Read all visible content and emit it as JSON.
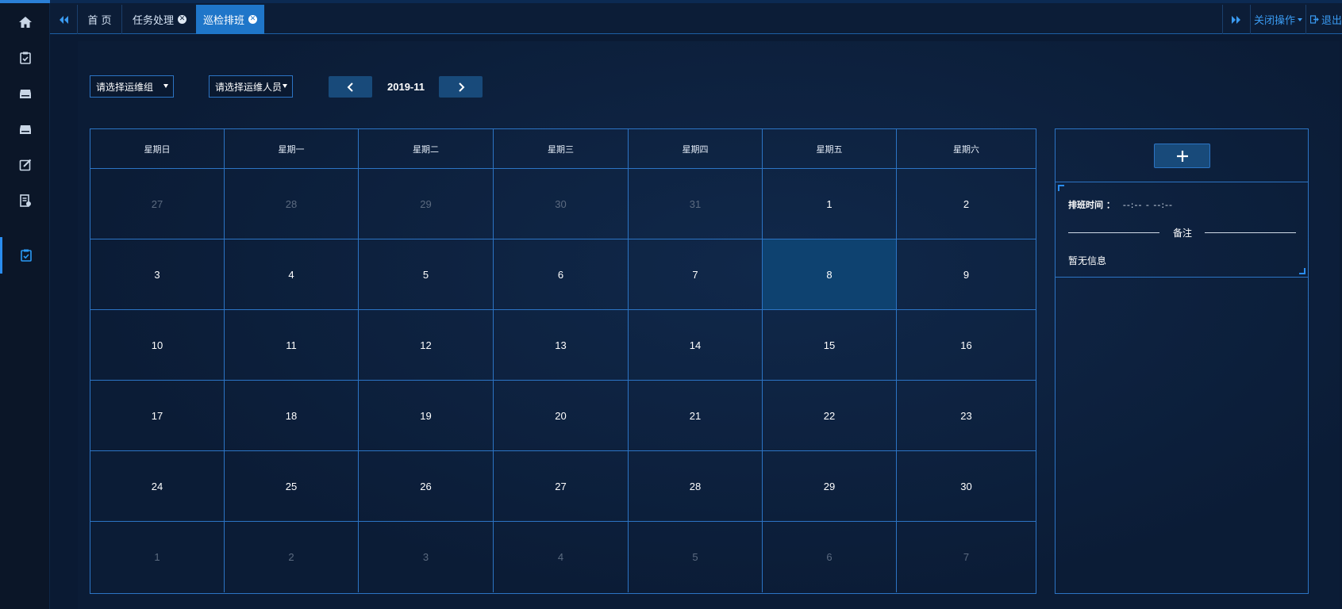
{
  "tabs": {
    "home": "首 页",
    "task": "任务处理",
    "patrol": "巡检排班",
    "close_ops": "关闭操作",
    "logout": "退出"
  },
  "rail": {
    "icons": [
      "home-icon",
      "task-check-icon",
      "storage-icon",
      "storage-icon",
      "edit-icon",
      "report-icon",
      "schedule-check-icon"
    ]
  },
  "filters": {
    "group_placeholder": "请选择运维组",
    "person_placeholder": "请选择运维人员"
  },
  "calendar": {
    "month": "2019-11",
    "weekdays": [
      "星期日",
      "星期一",
      "星期二",
      "星期三",
      "星期四",
      "星期五",
      "星期六"
    ],
    "weeks": [
      [
        "27",
        "28",
        "29",
        "30",
        "31",
        "1",
        "2"
      ],
      [
        "3",
        "4",
        "5",
        "6",
        "7",
        "8",
        "9"
      ],
      [
        "10",
        "11",
        "12",
        "13",
        "14",
        "15",
        "16"
      ],
      [
        "17",
        "18",
        "19",
        "20",
        "21",
        "22",
        "23"
      ],
      [
        "24",
        "25",
        "26",
        "27",
        "28",
        "29",
        "30"
      ],
      [
        "1",
        "2",
        "3",
        "4",
        "5",
        "6",
        "7"
      ]
    ],
    "selected": "8"
  },
  "panel": {
    "time_label": "排班时间 ：",
    "time_value": "--:--  -  --:--",
    "remark_label": "备注",
    "empty_text": "暂无信息"
  },
  "colors": {
    "accent": "#1f76c9",
    "border": "#2c74c4",
    "selected_cell": "#0e4270"
  }
}
